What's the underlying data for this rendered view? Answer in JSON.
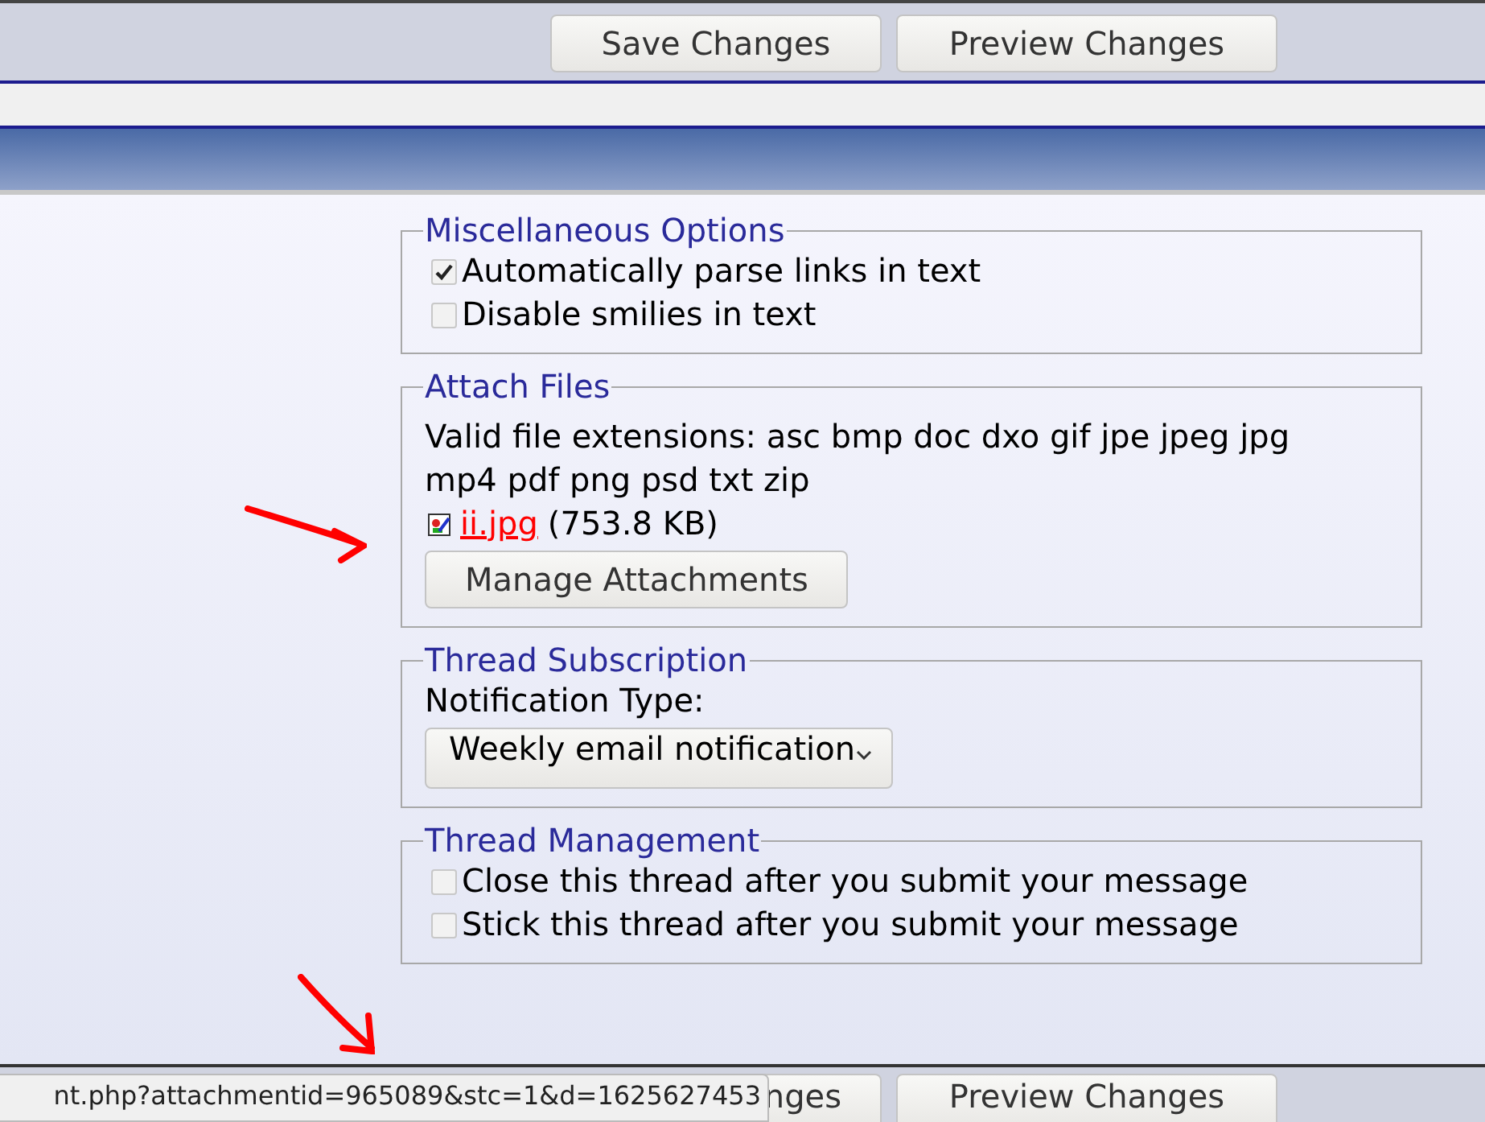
{
  "top_buttons": [
    {
      "label": "Save Changes"
    },
    {
      "label": "Preview Changes"
    }
  ],
  "sections": [
    {
      "kind": "checkboxes",
      "legend": "Miscellaneous Options",
      "options": [
        {
          "label": "Automatically parse links in text",
          "checked": true
        },
        {
          "label": "Disable smilies in text",
          "checked": false
        }
      ]
    },
    {
      "kind": "attachments",
      "legend": "Attach Files",
      "text": "Valid file extensions: asc bmp doc dxo gif jpe jpeg jpg mp4 pdf png psd txt zip",
      "file": {
        "name": "ii.jpg",
        "size": "(753.8 KB)"
      },
      "button": "Manage Attachments"
    },
    {
      "kind": "select",
      "legend": "Thread Subscription",
      "label": "Notification Type:",
      "value": "Weekly email notification"
    },
    {
      "kind": "checkboxes",
      "legend": "Thread Management",
      "options": [
        {
          "label": "Close this thread after you submit your message",
          "checked": false
        },
        {
          "label": "Stick this thread after you submit your message",
          "checked": false
        }
      ]
    }
  ],
  "bottom_buttons": [
    {
      "label": "nges"
    },
    {
      "label": "Preview Changes"
    }
  ],
  "status_url": "nt.php?attachmentid=965089&stc=1&d=1625627453",
  "annotations": [
    {
      "kind": "arrow"
    },
    {
      "kind": "arrow"
    }
  ]
}
